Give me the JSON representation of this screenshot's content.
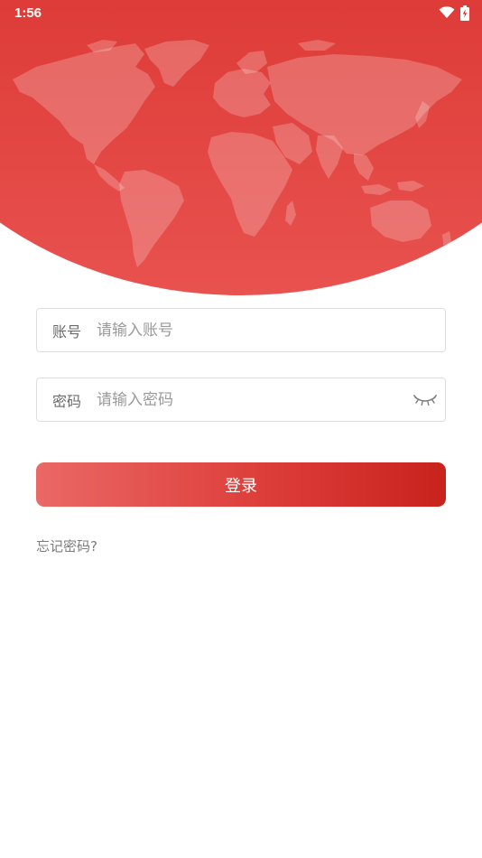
{
  "status_bar": {
    "time": "1:56",
    "icons": [
      "wifi-icon",
      "battery-charging-icon"
    ]
  },
  "header": {
    "background_colors": [
      "#cf2520",
      "#e8524f"
    ],
    "decoration": "world-map"
  },
  "form": {
    "account": {
      "label": "账号",
      "placeholder": "请输入账号",
      "value": ""
    },
    "password": {
      "label": "密码",
      "placeholder": "请输入密码",
      "value": "",
      "toggle_icon": "eye-closed-icon"
    },
    "login_label": "登录",
    "forgot_password": "忘记密码?"
  },
  "colors": {
    "accent": "#d32f2a",
    "button_gradient": [
      "#ea6866",
      "#c9221d"
    ]
  }
}
